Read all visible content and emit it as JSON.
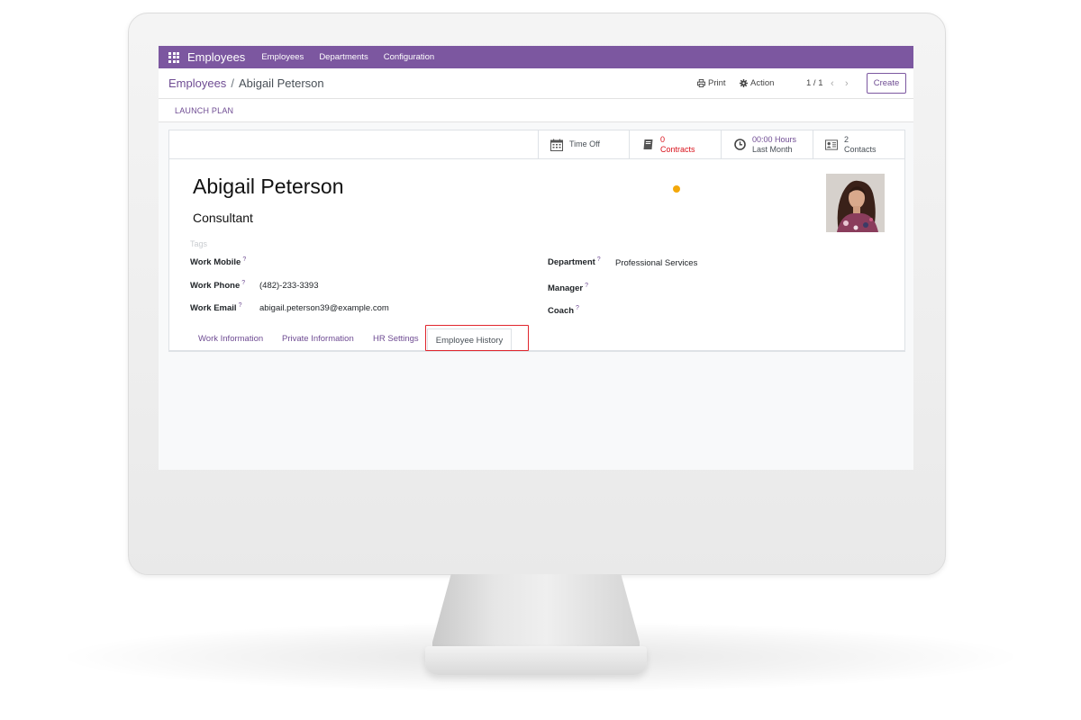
{
  "navbar": {
    "app_title": "Employees",
    "menu": [
      "Employees",
      "Departments",
      "Configuration"
    ]
  },
  "breadcrumb": {
    "parent": "Employees",
    "separator": "/",
    "current": "Abigail Peterson"
  },
  "control": {
    "print_label": "Print",
    "action_label": "Action",
    "pager": "1 / 1",
    "create_label": "Create"
  },
  "statusbar": {
    "launch_plan_label": "LAUNCH PLAN"
  },
  "smart_buttons": {
    "time_off": {
      "label": "Time Off"
    },
    "contracts": {
      "value": "0",
      "label": "Contracts"
    },
    "hours": {
      "value": "00:00 Hours",
      "label": "Last Month"
    },
    "contacts": {
      "value": "2",
      "label": "Contacts"
    }
  },
  "employee": {
    "name": "Abigail Peterson",
    "job_title": "Consultant",
    "tags_placeholder": "Tags",
    "status_color": "#f3a80b"
  },
  "fields": {
    "work_mobile": {
      "label": "Work Mobile",
      "help": "?",
      "value": ""
    },
    "work_phone": {
      "label": "Work Phone",
      "help": "?",
      "value": "(482)-233-3393"
    },
    "work_email": {
      "label": "Work Email",
      "help": "?",
      "value": "abigail.peterson39@example.com"
    },
    "department": {
      "label": "Department",
      "help": "?",
      "value": "Professional Services"
    },
    "manager": {
      "label": "Manager",
      "help": "?",
      "value": ""
    },
    "coach": {
      "label": "Coach",
      "help": "?",
      "value": ""
    }
  },
  "tabs": {
    "work_information": "Work Information",
    "private_information": "Private Information",
    "hr_settings": "HR Settings",
    "employee_history": "Employee History"
  },
  "colors": {
    "brand": "#7c57a0",
    "link": "#6f4c93",
    "alert": "#d9111b",
    "highlight": "#e0262d"
  }
}
